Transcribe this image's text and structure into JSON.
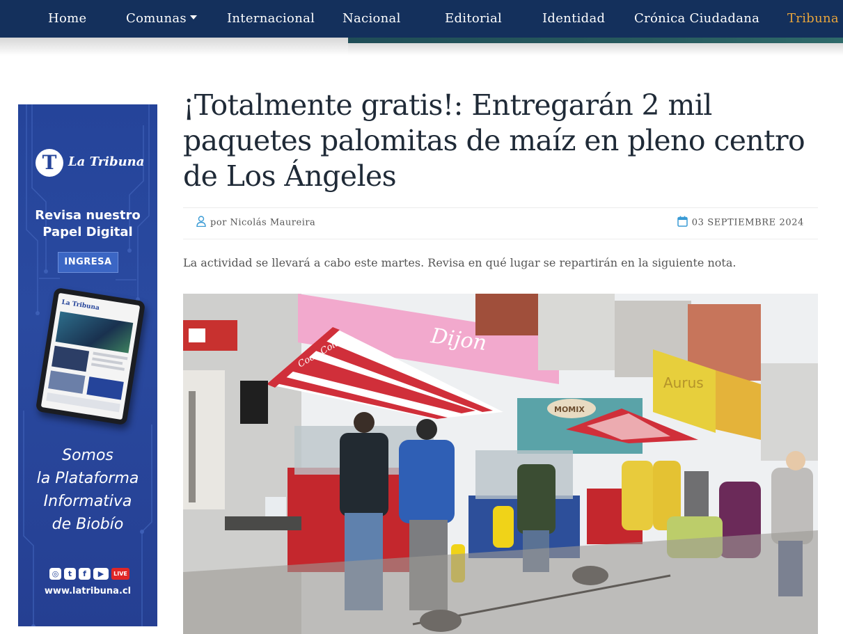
{
  "nav": {
    "items": [
      {
        "label": "Home"
      },
      {
        "label": "Comunas"
      },
      {
        "label": "Internacional"
      },
      {
        "label": "Nacional"
      },
      {
        "label": "Editorial"
      },
      {
        "label": "Identidad"
      },
      {
        "label": "Crónica Ciudadana"
      },
      {
        "label": "Tribuna"
      }
    ],
    "background_color": "#14305c",
    "active_color": "#e9a53b"
  },
  "ad": {
    "logo_letter": "T",
    "logo_text": "La Tribuna",
    "headline_line1": "Revisa nuestro",
    "headline_line2": "Papel Digital",
    "button_label": "INGRESA",
    "slogan_line1": "Somos",
    "slogan_line2": "la Plataforma",
    "slogan_line3": "Informativa",
    "slogan_line4": "de Biobío",
    "live_label": "LIVE",
    "url": "www.latribuna.cl",
    "background_color": "#25449a"
  },
  "article": {
    "title": "¡Totalmente gratis!: Entregarán 2 mil paquetes palomitas de maíz en pleno centro de Los Ángeles",
    "author": "por Nicolás Maureira",
    "date": "03 SEPTIEMBRE 2024",
    "lead": "La actividad se llevará a cabo este martes. Revisa en qué lugar se repartirán en la siguiente nota.",
    "accent_color": "#3a9bd5"
  },
  "photo": {
    "sign_dijon": "Dijon",
    "sign_cocacola": "Coca-Cola",
    "sign_aurus": "Aurus",
    "sign_momix": "MOMIX"
  }
}
